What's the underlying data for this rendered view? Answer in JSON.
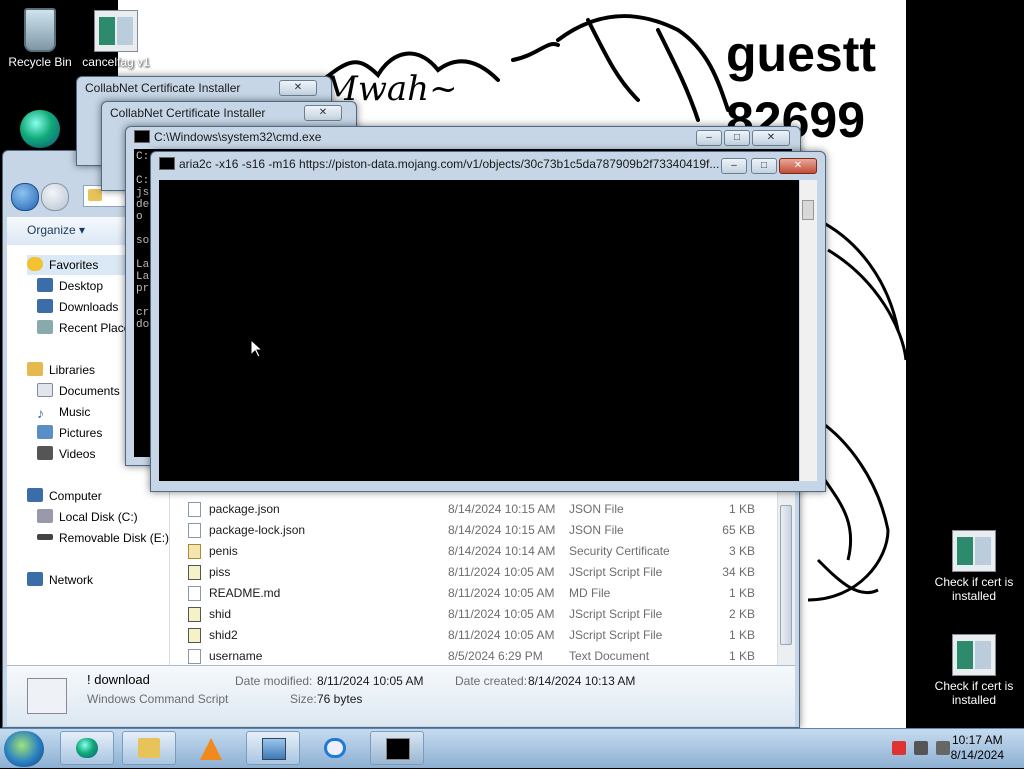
{
  "desktop": {
    "icons": [
      {
        "label": "Recycle Bin"
      },
      {
        "label": "cancelfag v1"
      },
      {
        "label": "Check if cert is installed"
      },
      {
        "label": "Check if cert is installed"
      }
    ],
    "wallpaper_text": [
      "guestt",
      "82699"
    ],
    "wallpaper_script": "Mwah~"
  },
  "explorer": {
    "organize": "Organize",
    "nav": {
      "favorites": "Favorites",
      "desktop": "Desktop",
      "downloads": "Downloads",
      "recent": "Recent Place",
      "libraries": "Libraries",
      "documents": "Documents",
      "music": "Music",
      "pictures": "Pictures",
      "videos": "Videos",
      "computer": "Computer",
      "local_disk": "Local Disk (C:)",
      "removable": "Removable Disk (E:)",
      "network": "Network"
    },
    "files": [
      {
        "name": "package.json",
        "date": "8/14/2024 10:15 AM",
        "type": "JSON File",
        "size": "1 KB"
      },
      {
        "name": "package-lock.json",
        "date": "8/14/2024 10:15 AM",
        "type": "JSON File",
        "size": "65 KB"
      },
      {
        "name": "penis",
        "date": "8/14/2024 10:14 AM",
        "type": "Security Certificate",
        "size": "3 KB"
      },
      {
        "name": "piss",
        "date": "8/11/2024 10:05 AM",
        "type": "JScript Script File",
        "size": "34 KB"
      },
      {
        "name": "README.md",
        "date": "8/11/2024 10:05 AM",
        "type": "MD File",
        "size": "1 KB"
      },
      {
        "name": "shid",
        "date": "8/11/2024 10:05 AM",
        "type": "JScript Script File",
        "size": "2 KB"
      },
      {
        "name": "shid2",
        "date": "8/11/2024 10:05 AM",
        "type": "JScript Script File",
        "size": "1 KB"
      },
      {
        "name": "username",
        "date": "8/5/2024 6:29 PM",
        "type": "Text Document",
        "size": "1 KB"
      }
    ],
    "details": {
      "name": "! download",
      "kind": "Windows Command Script",
      "modified_label": "Date modified:",
      "modified": "8/11/2024 10:05 AM",
      "created_label": "Date created:",
      "created": "8/14/2024 10:13 AM",
      "size_label": "Size:",
      "size": "76 bytes"
    }
  },
  "cert_windows": [
    {
      "title": "CollabNet Certificate Installer"
    },
    {
      "title": "CollabNet Certificate Installer"
    }
  ],
  "cmd": {
    "title": "C:\\Windows\\system32\\cmd.exe",
    "lines": [
      "C:",
      "",
      "C:",
      "js",
      "de",
      "o",
      "",
      "so",
      "",
      "La",
      "La",
      "pr",
      "",
      "cr",
      "do"
    ]
  },
  "aria": {
    "title": "aria2c  -x16 -s16 -m16 https://piston-data.mojang.com/v1/objects/30c73b1c5da787909b2f73340419f..."
  },
  "taskbar": {
    "time": "10:17 AM",
    "date": "8/14/2024"
  }
}
